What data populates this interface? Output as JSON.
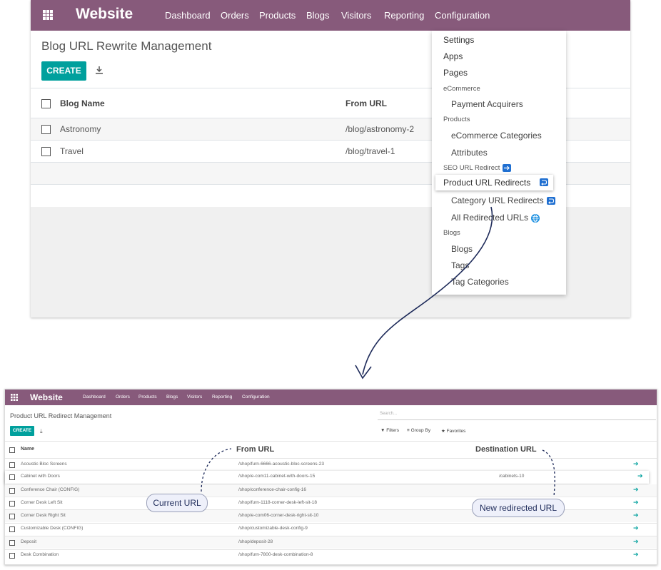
{
  "top": {
    "brand": "Website",
    "menu": [
      "Dashboard",
      "Orders",
      "Products",
      "Blogs",
      "Visitors",
      "Reporting",
      "Configuration"
    ],
    "page_title": "Blog URL Rewrite Management",
    "create_label": "CREATE",
    "columns": {
      "name": "Blog Name",
      "from_url": "From URL"
    },
    "rows": [
      {
        "name": "Astronomy",
        "from_url": "/blog/astronomy-2"
      },
      {
        "name": "Travel",
        "from_url": "/blog/travel-1"
      }
    ],
    "dropdown": {
      "settings": "Settings",
      "apps": "Apps",
      "pages": "Pages",
      "ecommerce_section": "eCommerce",
      "payment_acquirers": "Payment Acquirers",
      "products_section": "Products",
      "ecommerce_categories": "eCommerce Categories",
      "attributes": "Attributes",
      "seo_section": "SEO URL Redirect",
      "product_url_redirects": "Product URL Redirects",
      "category_url_redirects": "Category URL Redirects",
      "all_redirected_urls": "All Redirected URLs",
      "blogs_section": "Blogs",
      "blogs": "Blogs",
      "tags": "Tags",
      "tag_categories": "Tag Categories"
    }
  },
  "bottom": {
    "brand": "Website",
    "menu": [
      "Dashboard",
      "Orders",
      "Products",
      "Blogs",
      "Visitors",
      "Reporting",
      "Configuration"
    ],
    "page_title": "Product URL Redirect Management",
    "search_placeholder": "Search...",
    "create_label": "CREATE",
    "filters_label": "Filters",
    "group_by_label": "Group By",
    "favorites_label": "Favorites",
    "columns": {
      "name": "Name",
      "from_url": "From URL",
      "destination_url": "Destination URL"
    },
    "rows": [
      {
        "name": "Acoustic Bloc Screens",
        "from_url": "/shop/furn-6666-acoustic-bloc-screens-23",
        "destination_url": ""
      },
      {
        "name": "Cabinet with Doors",
        "from_url": "/shop/e-com11-cabinet-with-doors-15",
        "destination_url": "/cabinets-10"
      },
      {
        "name": "Conference Chair (CONFIG)",
        "from_url": "/shop/conference-chair-config-16",
        "destination_url": ""
      },
      {
        "name": "Corner Desk Left Sit",
        "from_url": "/shop/furn-1118-corner-desk-left-sit-18",
        "destination_url": ""
      },
      {
        "name": "Corner Desk Right Sit",
        "from_url": "/shop/e-com06-corner-desk-right-sit-10",
        "destination_url": ""
      },
      {
        "name": "Customizable Desk (CONFIG)",
        "from_url": "/shop/customizable-desk-config-9",
        "destination_url": ""
      },
      {
        "name": "Deposit",
        "from_url": "/shop/deposit-28",
        "destination_url": ""
      },
      {
        "name": "Desk Combination",
        "from_url": "/shop/furn-7800-desk-combination-8",
        "destination_url": ""
      }
    ]
  },
  "annotations": {
    "current_url": "Current URL",
    "new_redirected_url": "New redirected URL"
  }
}
